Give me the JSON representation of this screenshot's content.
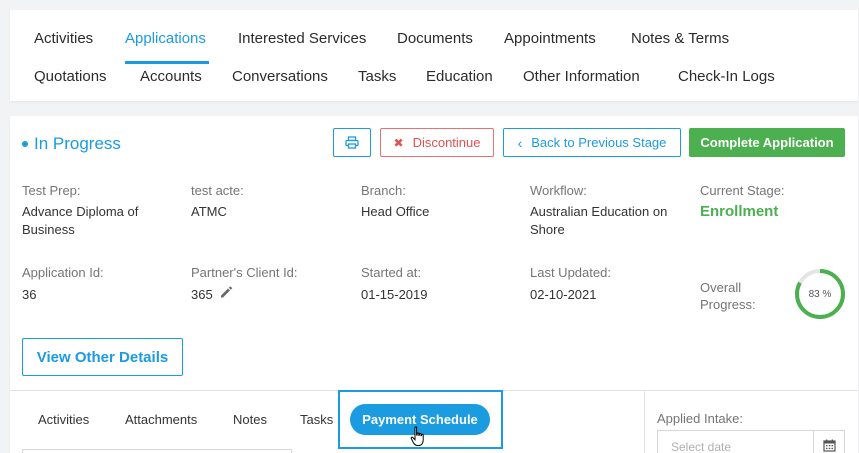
{
  "tabs": {
    "row1": [
      "Activities",
      "Applications",
      "Interested Services",
      "Documents",
      "Appointments",
      "Notes & Terms"
    ],
    "row2": [
      "Quotations",
      "Accounts",
      "Conversations",
      "Tasks",
      "Education",
      "Other Information",
      "Check-In Logs"
    ],
    "active": "Applications"
  },
  "application": {
    "status": "In Progress",
    "actions": {
      "print_icon": "printer-icon",
      "discontinue": "Discontinue",
      "back": "Back to Previous Stage",
      "complete": "Complete Application"
    },
    "fields": {
      "test_prep_label": "Test Prep:",
      "test_prep_value": "Advance Diploma of Business",
      "test_acte_label": "test acte:",
      "test_acte_value": "ATMC",
      "branch_label": "Branch:",
      "branch_value": "Head Office",
      "workflow_label": "Workflow:",
      "workflow_value": "Australian Education on Shore",
      "current_stage_label": "Current Stage:",
      "current_stage_value": "Enrollment",
      "application_id_label": "Application Id:",
      "application_id_value": "36",
      "partner_client_id_label": "Partner's Client Id:",
      "partner_client_id_value": "365",
      "started_at_label": "Started at:",
      "started_at_value": "01-15-2019",
      "last_updated_label": "Last Updated:",
      "last_updated_value": "02-10-2021",
      "overall_progress_label": "Overall Progress:",
      "overall_progress_text": "83 %",
      "overall_progress_value": 0.83
    },
    "view_details": "View Other Details"
  },
  "subtabs": {
    "items": [
      "Activities",
      "Attachments",
      "Notes",
      "Tasks"
    ],
    "active": "Payment Schedule"
  },
  "intake": {
    "label": "Applied Intake:",
    "placeholder": "Select date"
  },
  "colors": {
    "accent": "#1b9be0",
    "success": "#4caf50",
    "danger": "#e05252"
  }
}
